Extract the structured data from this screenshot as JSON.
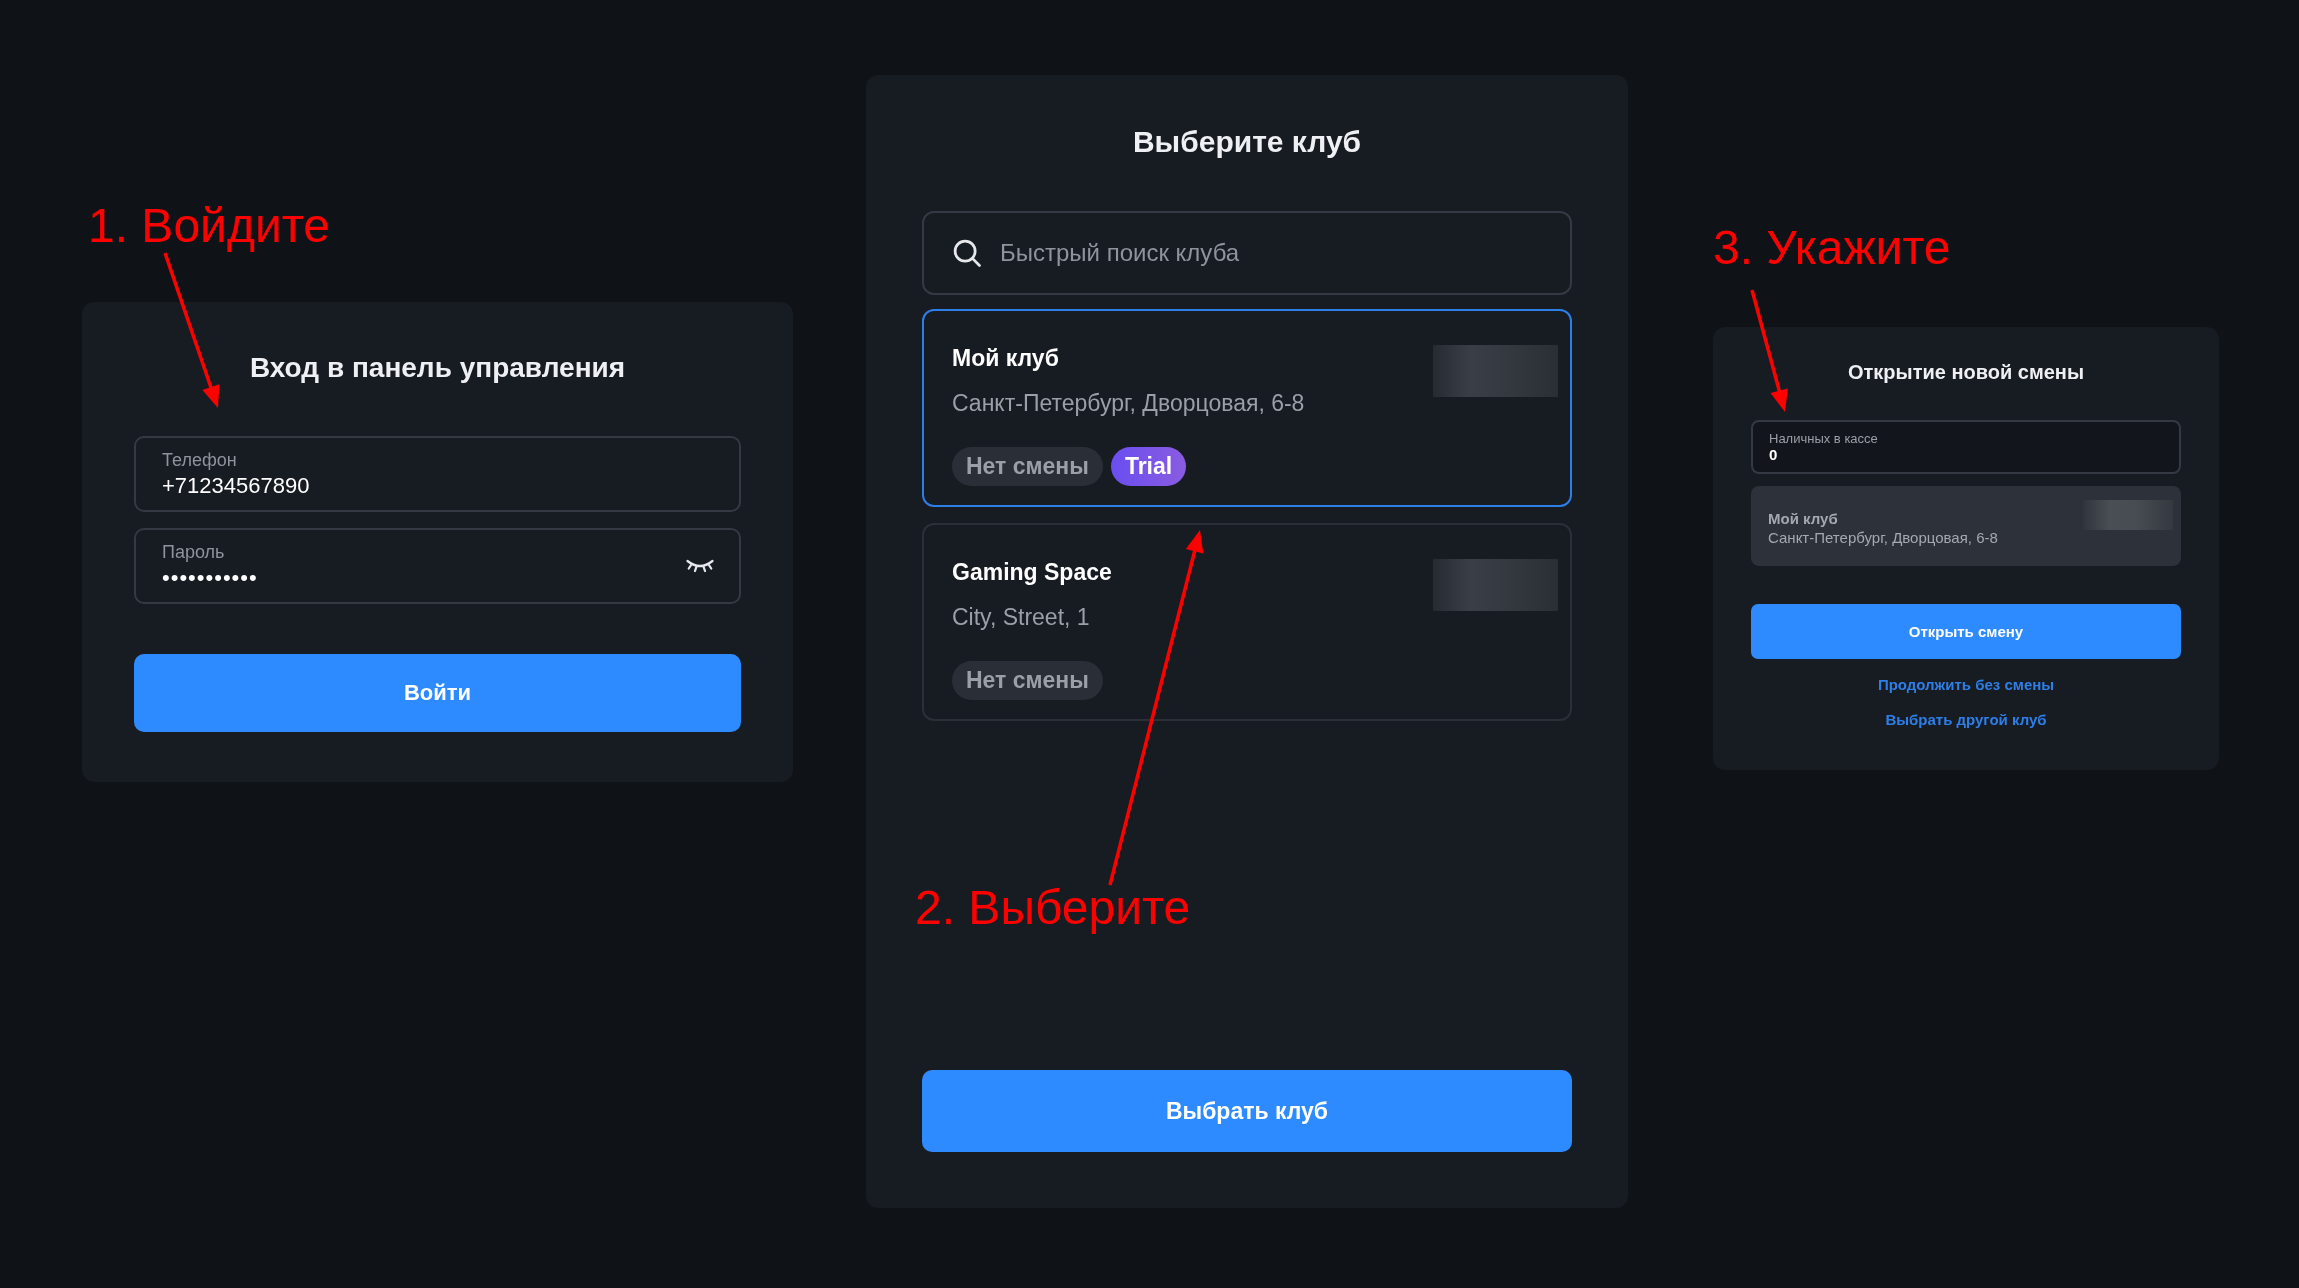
{
  "annotations": [
    {
      "text": "1. Войдите"
    },
    {
      "text": "2. Выберите"
    },
    {
      "text": "3. Укажите"
    }
  ],
  "login": {
    "title": "Вход в панель управления",
    "fields": [
      {
        "label": "Телефон",
        "value": "+71234567890",
        "kind": "text"
      },
      {
        "label": "Пароль",
        "value": "•••••••••••",
        "kind": "password"
      }
    ],
    "button": "Войти"
  },
  "club_select": {
    "title": "Выберите клуб",
    "search": {
      "placeholder": "Быстрый поиск клуба"
    },
    "clubs": [
      {
        "name": "Мой клуб",
        "address": "Санкт-Петербург, Дворцовая, 6-8",
        "selected": true,
        "tags": [
          {
            "text": "Нет смены",
            "kind": "status"
          },
          {
            "text": "Trial",
            "kind": "plan"
          }
        ]
      },
      {
        "name": "Gaming Space",
        "address": "City, Street, 1",
        "selected": false,
        "tags": [
          {
            "text": "Нет смены",
            "kind": "status"
          }
        ]
      }
    ],
    "button": "Выбрать клуб"
  },
  "open_shift": {
    "title": "Открытие новой смены",
    "field": {
      "label": "Наличных в кассе",
      "value": "0"
    },
    "club": {
      "name": "Мой клуб",
      "address": "Санкт-Петербург, Дворцовая, 6-8"
    },
    "button": "Открыть смену",
    "links": [
      "Продолжить без смены",
      "Выбрать другой клуб"
    ]
  }
}
